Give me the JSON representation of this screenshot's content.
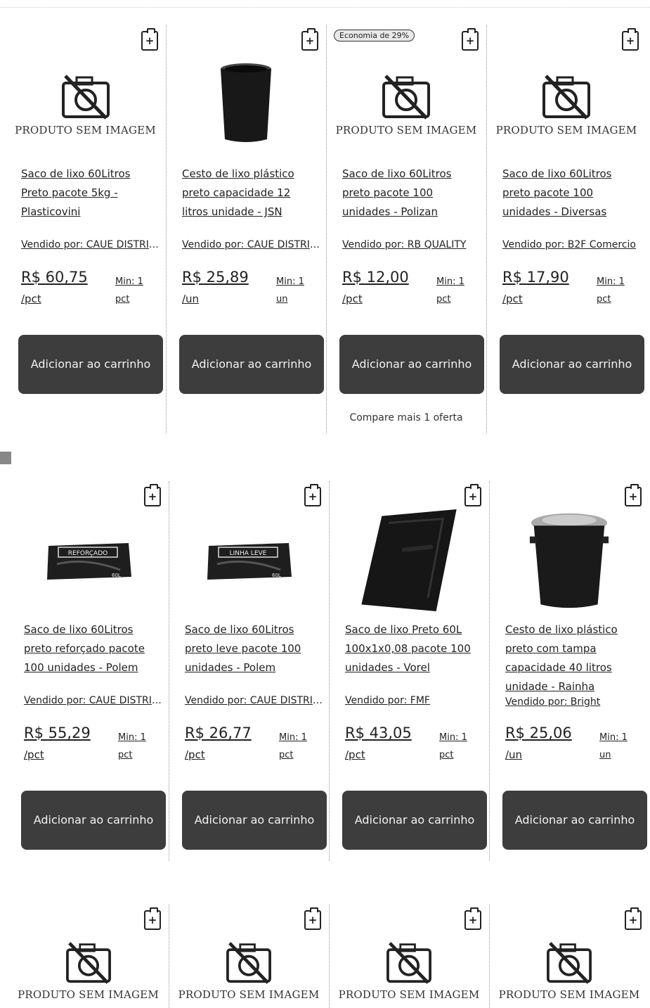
{
  "no_image_text": "PRODUTO SEM IMAGEM",
  "add_label": "Adicionar ao carrinho",
  "compare_text": "Compare mais 1 oferta",
  "badge_text": "Economia de 29%",
  "clip_symbol": "+",
  "rows": [
    {
      "products": [
        {
          "image": "no-image",
          "title": "Saco de lixo 60Litros Preto pacote 5kg - Plasticovini",
          "seller": "Vendido por: CAUE DISTRIBUIDORA",
          "price": "R$ 60,75",
          "unit": "/pct",
          "min": "Min: 1 pct"
        },
        {
          "image": "black-bin",
          "title": "Cesto de lixo plástico preto capacidade 12 litros unidade - JSN",
          "seller": "Vendido por: CAUE DISTRIBUIDORA",
          "price": "R$ 25,89",
          "unit": "/un",
          "min": "Min: 1 un"
        },
        {
          "image": "no-image",
          "title": "Saco de lixo 60Litros preto pacote 100 unidades - Polizan",
          "seller": "Vendido por: RB QUALITY",
          "price": "R$ 12,00",
          "unit": "/pct",
          "min": "Min: 1 pct"
        },
        {
          "image": "no-image",
          "title": "Saco de lixo 60Litros preto pacote 100 unidades - Diversas",
          "seller": "Vendido por: B2F Comercio",
          "price": "R$ 17,90",
          "unit": "/pct",
          "min": "Min: 1 pct"
        }
      ]
    },
    {
      "products": [
        {
          "image": "bag-pack",
          "pack_label": "REFORÇADO",
          "title": "Saco de lixo 60Litros preto reforçado pacote 100 unidades - Polem",
          "seller": "Vendido por: CAUE DISTRIBUIDORA",
          "price": "R$ 55,29",
          "unit": "/pct",
          "min": "Min: 1 pct"
        },
        {
          "image": "bag-pack",
          "pack_label": "LINHA LEVE",
          "title": "Saco de lixo 60Litros preto leve pacote 100 unidades - Polem",
          "seller": "Vendido por: CAUE DISTRIBUIDORA",
          "price": "R$ 26,77",
          "unit": "/pct",
          "min": "Min: 1 pct"
        },
        {
          "image": "black-bags",
          "title": "Saco de lixo Preto 60L 100x1x0,08 pacote 100 unidades - Vorel",
          "seller": "Vendido por: FMF",
          "price": "R$ 43,05",
          "unit": "/pct",
          "min": "Min: 1 pct"
        },
        {
          "image": "lidded-bin",
          "title": "Cesto de lixo plástico preto com tampa capacidade 40 litros unidade - Rainha",
          "seller": "Vendido por: Bright",
          "price": "R$ 25,06",
          "unit": "/un",
          "min": "Min: 1 un"
        }
      ]
    },
    {
      "products": [
        {
          "image": "no-image"
        },
        {
          "image": "no-image"
        },
        {
          "image": "no-image"
        },
        {
          "image": "no-image"
        }
      ]
    }
  ]
}
